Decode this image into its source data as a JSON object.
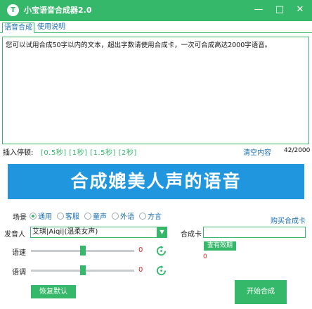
{
  "app": {
    "title": "小宝语音合成器2.0",
    "logo_glyph": "T",
    "accent_color": "#35b86a",
    "banner_color": "#1f96de"
  },
  "window_controls": {
    "minimize_glyph": "—",
    "maximize_glyph": "□",
    "close_glyph": "✕"
  },
  "tabs": [
    {
      "label": "语音合成",
      "active": true
    },
    {
      "label": "使用说明",
      "active": false
    }
  ],
  "editor": {
    "text": "您可以试用合成50字以内的文本，超出字数请使用合成卡，一次可合成高达2000字语音。"
  },
  "pause": {
    "label": "插入停顿:",
    "options": "[0.5秒] [1秒] [1.5秒] [2秒]"
  },
  "clear_label": "清空内容",
  "char_count": "42/2000",
  "banner": {
    "text": "合成媲美人声的语音"
  },
  "scene": {
    "label": "场景",
    "options": [
      {
        "label": "通用",
        "selected": true
      },
      {
        "label": "客服",
        "selected": false
      },
      {
        "label": "童声",
        "selected": false
      },
      {
        "label": "外语",
        "selected": false
      },
      {
        "label": "方言",
        "selected": false
      }
    ]
  },
  "buy_card_label": "购买合成卡",
  "speaker": {
    "label": "发音人",
    "selected": "艾琪|Aiqi|(温柔女声)",
    "arrow_icon": "triangle-down"
  },
  "card": {
    "label": "合成卡",
    "value": "",
    "check_label": "查有效期",
    "status": "0"
  },
  "speed": {
    "label": "语速",
    "value": "0",
    "level_fraction": 0.5
  },
  "tone": {
    "label": "语调",
    "value": "0",
    "level_fraction": 0.5
  },
  "restore_label": "恢复默认",
  "synthesize_label": "开始合成"
}
